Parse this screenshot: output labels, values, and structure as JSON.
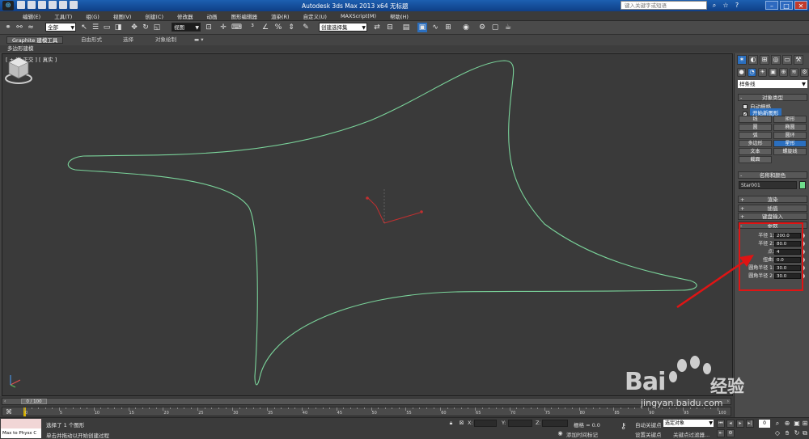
{
  "titlebar": {
    "title": "Autodesk 3ds Max  2013 x64      无标题",
    "search_placeholder": "键入关键字或短语"
  },
  "menu": [
    "编辑(E)",
    "工具(T)",
    "组(G)",
    "视图(V)",
    "创建(C)",
    "修改器",
    "动画",
    "图形编辑器",
    "渲染(R)",
    "自定义(U)",
    "MAXScript(M)",
    "帮助(H)"
  ],
  "toolbar": {
    "selection_filter": "全部",
    "reference_coord": "视图",
    "named_selection": "创建选择集"
  },
  "ribbon": {
    "tabs": [
      "Graphite 建模工具",
      "自由形式",
      "选择",
      "对象绘制"
    ],
    "sub_label": "多边形建模"
  },
  "viewport": {
    "label": "[ + ] [ 正交 ] [ 真实 ]",
    "shape_color": "#7ad39a"
  },
  "command_panel": {
    "category": "样条线",
    "rollout_object_type": "对象类型",
    "auto_grid": "自动栅格",
    "start_new_shape": "开始新图形",
    "shape_buttons": [
      "线",
      "矩形",
      "圆",
      "椭圆",
      "弧",
      "圆环",
      "多边形",
      "星形",
      "文本",
      "螺旋线",
      "截面"
    ],
    "active_button": "星形",
    "rollout_name_color": "名称和颜色",
    "object_name": "Star001",
    "rollout_render": "渲染",
    "rollout_interpolation": "插值",
    "rollout_keyboard": "键盘输入",
    "rollout_params": "参数",
    "params": [
      {
        "label": "半径 1:",
        "value": "200.0"
      },
      {
        "label": "半径 2:",
        "value": "80.0"
      },
      {
        "label": "点:",
        "value": "4"
      },
      {
        "label": "扭曲:",
        "value": "0.0"
      },
      {
        "label": "圆角半径 1:",
        "value": "30.0"
      },
      {
        "label": "圆角半径 2:",
        "value": "30.0"
      }
    ]
  },
  "timeline": {
    "frame_display": "0 / 100",
    "ticks": [
      "0",
      "5",
      "10",
      "15",
      "20",
      "25",
      "30",
      "35",
      "40",
      "45",
      "50",
      "55",
      "60",
      "65",
      "70",
      "75",
      "80",
      "85",
      "90",
      "95",
      "100"
    ]
  },
  "status": {
    "maxscript_label": "Max to Physx C",
    "selected": "选择了 1 个图形",
    "prompt": "单击并拖动以开始创建过程",
    "x_label": "X:",
    "y_label": "Y:",
    "z_label": "Z:",
    "grid": "栅格 = 0.0",
    "add_time_tag": "添加时间标记",
    "auto_key": "自动关键点",
    "set_key": "设置关键点",
    "key_mode": "选定对象",
    "key_filters": "关键点过滤器...",
    "frame": "0"
  },
  "watermark": {
    "brand": "Bai",
    "brand_cn": "经验",
    "url": "jingyan.baidu.com"
  }
}
